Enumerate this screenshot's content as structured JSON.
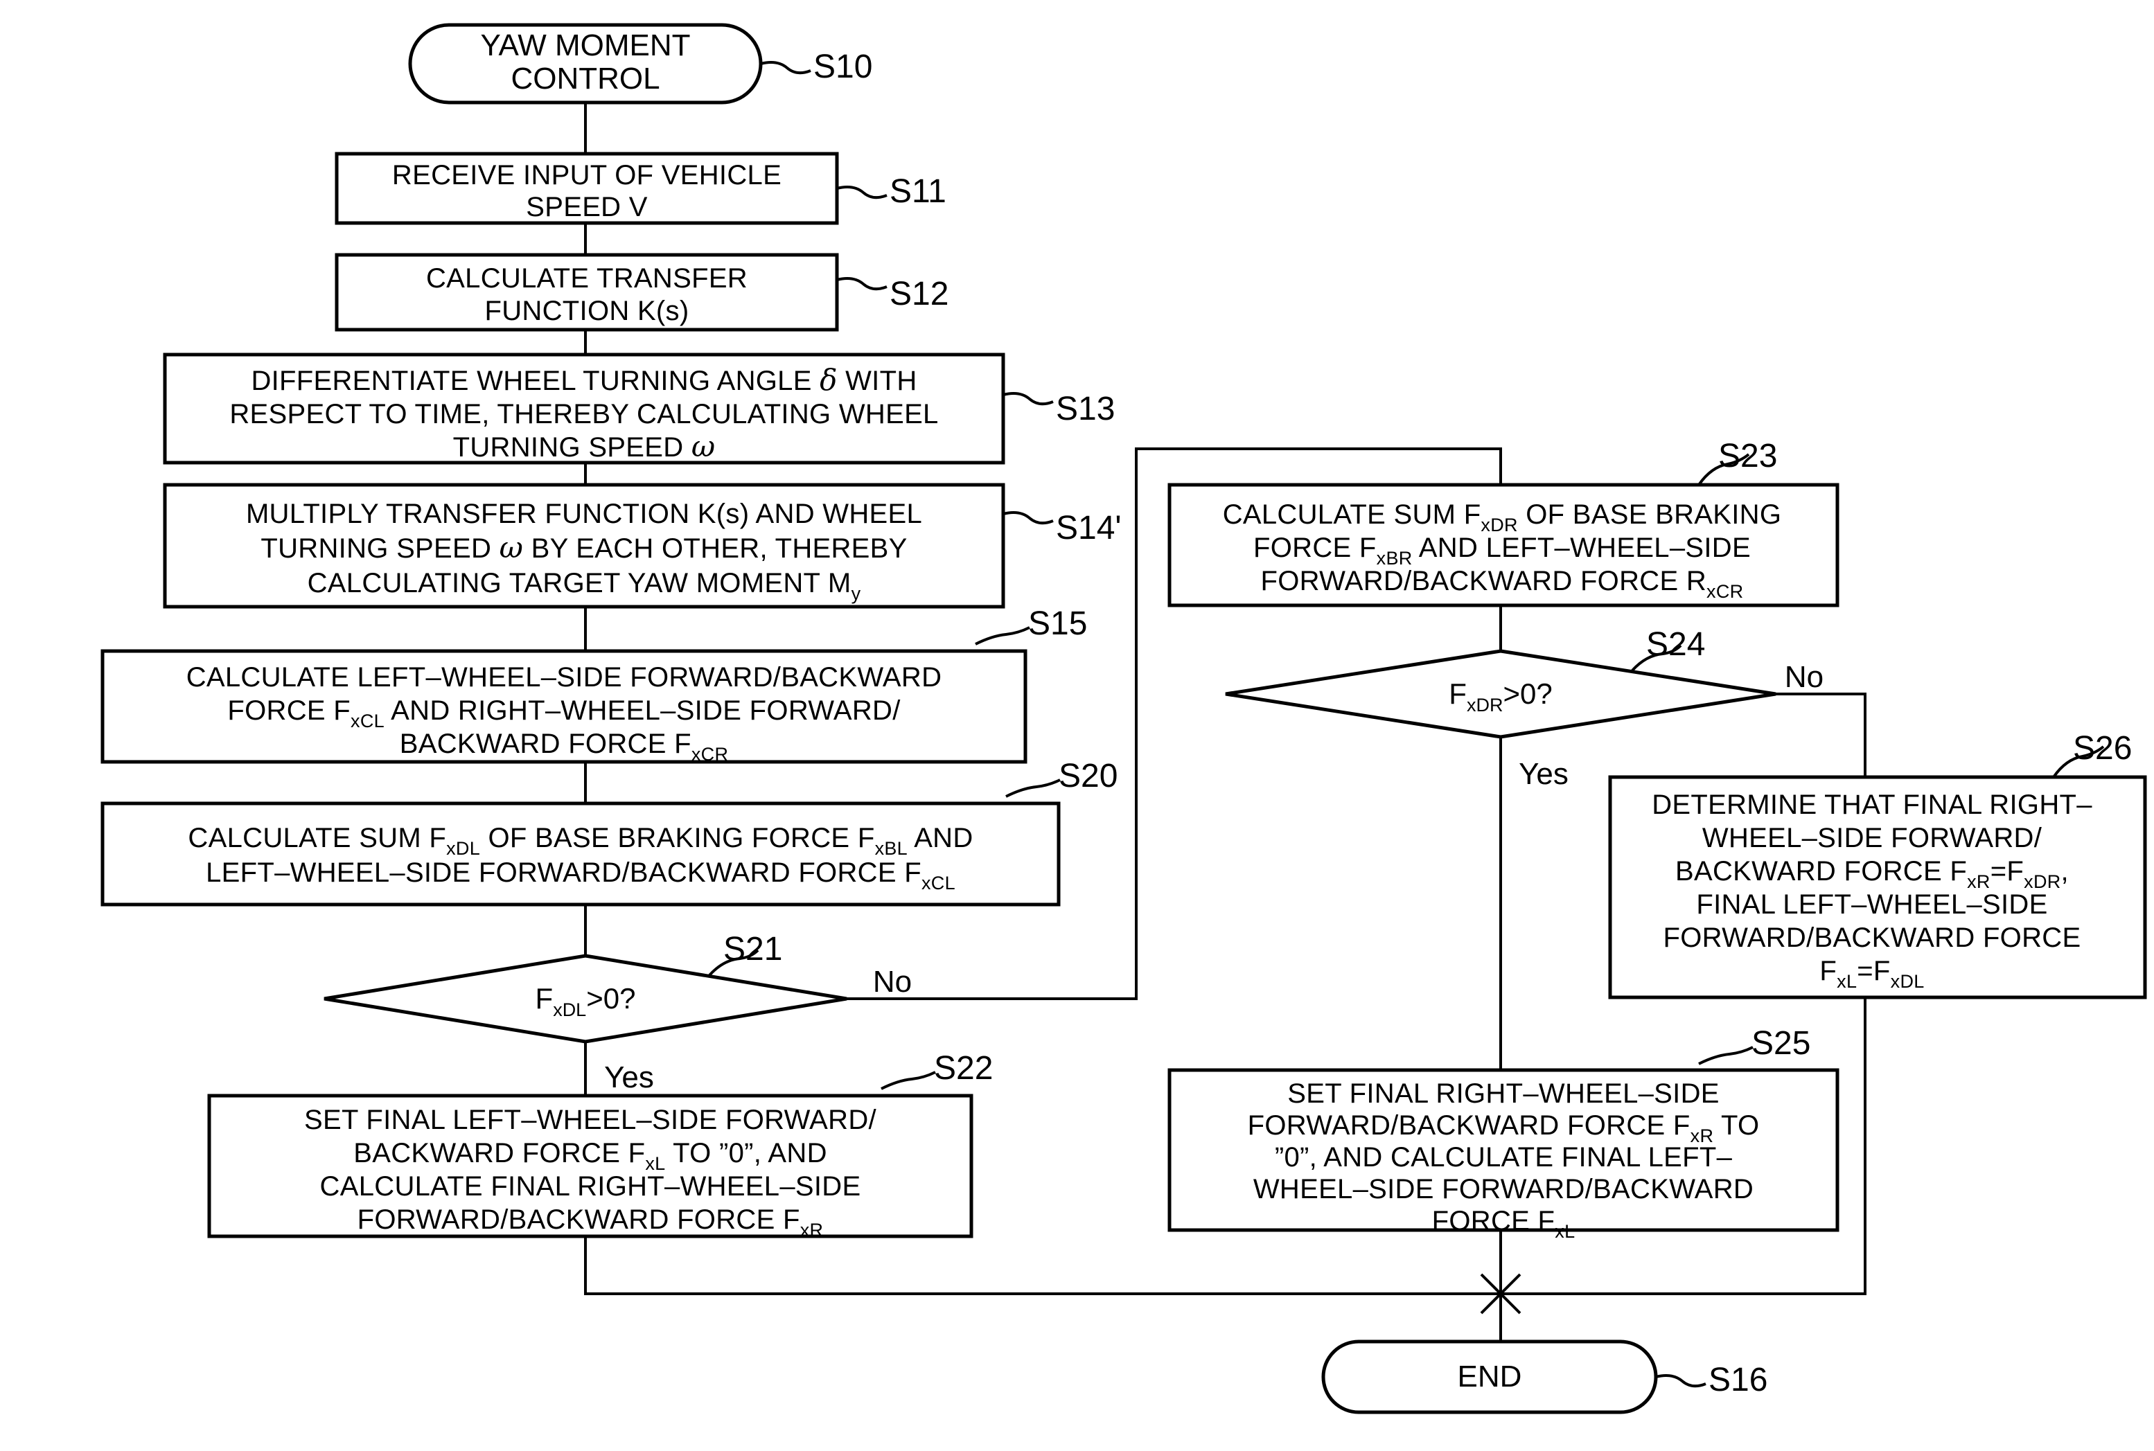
{
  "diagram": {
    "title": "YAW MOMENT CONTROL flowchart",
    "nodes": {
      "s10": {
        "label": "S10",
        "type": "terminator",
        "lines": [
          "YAW MOMENT",
          "CONTROL"
        ]
      },
      "s11": {
        "label": "S11",
        "type": "process",
        "lines": [
          "RECEIVE INPUT OF VEHICLE",
          "SPEED V"
        ]
      },
      "s12": {
        "label": "S12",
        "type": "process",
        "lines": [
          "CALCULATE TRANSFER",
          "FUNCTION K(s)"
        ]
      },
      "s13": {
        "label": "S13",
        "type": "process",
        "lines": [
          "DIFFERENTIATE WHEEL TURNING ANGLE δ WITH",
          "RESPECT TO TIME, THEREBY CALCULATING WHEEL",
          "TURNING SPEED ω"
        ]
      },
      "s14": {
        "label": "S14'",
        "type": "process",
        "lines": [
          "MULTIPLY TRANSFER FUNCTION K(s) AND WHEEL",
          "TURNING SPEED ω BY EACH OTHER, THEREBY",
          "CALCULATING TARGET YAW MOMENT My"
        ]
      },
      "s15": {
        "label": "S15",
        "type": "process",
        "lines": [
          "CALCULATE LEFT-WHEEL-SIDE FORWARD/BACKWARD",
          "FORCE FxCL AND RIGHT-WHEEL-SIDE FORWARD/",
          "BACKWARD FORCE FxCR"
        ]
      },
      "s20": {
        "label": "S20",
        "type": "process",
        "lines": [
          "CALCULATE SUM FxDL OF BASE BRAKING FORCE FxBL AND",
          "LEFT-WHEEL-SIDE FORWARD/BACKWARD FORCE FxCL"
        ]
      },
      "s21": {
        "label": "S21",
        "type": "decision",
        "condition": "FxDL>0?",
        "yes_label": "Yes",
        "no_label": "No"
      },
      "s22": {
        "label": "S22",
        "type": "process",
        "lines": [
          "SET FINAL LEFT-WHEEL-SIDE FORWARD/",
          "BACKWARD FORCE FxL TO ”0”, AND",
          "CALCULATE FINAL RIGHT-WHEEL-SIDE",
          "FORWARD/BACKWARD FORCE FxR"
        ]
      },
      "s23": {
        "label": "S23",
        "type": "process",
        "lines": [
          "CALCULATE SUM FxDR OF BASE BRAKING",
          "FORCE FxBR AND LEFT-WHEEL-SIDE",
          "FORWARD/BACKWARD FORCE RxCR"
        ]
      },
      "s24": {
        "label": "S24",
        "type": "decision",
        "condition": "FxDR>0?",
        "yes_label": "Yes",
        "no_label": "No"
      },
      "s25": {
        "label": "S25",
        "type": "process",
        "lines": [
          "SET FINAL RIGHT-WHEEL-SIDE",
          "FORWARD/BACKWARD FORCE FxR TO",
          "”0”, AND CALCULATE FINAL LEFT-",
          "WHEEL-SIDE FORWARD/BACKWARD",
          "FORCE FxL"
        ]
      },
      "s26": {
        "label": "S26",
        "type": "process",
        "lines": [
          "DETERMINE THAT FINAL RIGHT-",
          "WHEEL-SIDE FORWARD/",
          "BACKWARD FORCE FxR=FxDR,",
          "FINAL LEFT-WHEEL-SIDE",
          "FORWARD/BACKWARD FORCE",
          "FxL=FxDL"
        ]
      },
      "s16": {
        "label": "S16",
        "type": "terminator",
        "lines": [
          "END"
        ]
      }
    },
    "colors": {
      "stroke": "#000000",
      "fill": "#ffffff",
      "text": "#000000"
    }
  }
}
